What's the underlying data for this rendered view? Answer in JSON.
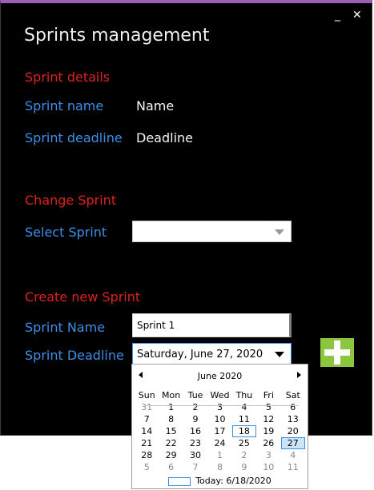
{
  "window": {
    "title": "Sprints management",
    "minimize_glyph": "_",
    "close_glyph": "✕"
  },
  "sprint_details": {
    "heading": "Sprint details",
    "name_label": "Sprint name",
    "name_value": "Name",
    "deadline_label": "Sprint deadline",
    "deadline_value": "Deadline"
  },
  "change_sprint": {
    "heading": "Change Sprint",
    "select_label": "Select Sprint",
    "select_value": ""
  },
  "create_sprint": {
    "heading": "Create new Sprint",
    "name_label": "Sprint Name",
    "name_input_value": "Sprint 1",
    "deadline_label": "Sprint Deadline",
    "deadline_value": "Saturday, June 27, 2020",
    "add_button_icon": "plus-icon"
  },
  "calendar": {
    "month_label": "June 2020",
    "weekdays": [
      "Sun",
      "Mon",
      "Tue",
      "Wed",
      "Thu",
      "Fri",
      "Sat"
    ],
    "weeks": [
      [
        "31",
        "1",
        "2",
        "3",
        "4",
        "5",
        "6"
      ],
      [
        "7",
        "8",
        "9",
        "10",
        "11",
        "12",
        "13"
      ],
      [
        "14",
        "15",
        "16",
        "17",
        "18",
        "19",
        "20"
      ],
      [
        "21",
        "22",
        "23",
        "24",
        "25",
        "26",
        "27"
      ],
      [
        "28",
        "29",
        "30",
        "1",
        "2",
        "3",
        "4"
      ],
      [
        "5",
        "6",
        "7",
        "8",
        "9",
        "10",
        "11"
      ]
    ],
    "today_day": "18",
    "selected_day": "27",
    "today_label": "Today: 6/18/2020"
  },
  "colors": {
    "window_background": "#000000",
    "title_bar_accent": "#9b5fb8",
    "section_heading": "#e02020",
    "field_label": "#3c8ee6",
    "add_button": "#8cc63f"
  }
}
